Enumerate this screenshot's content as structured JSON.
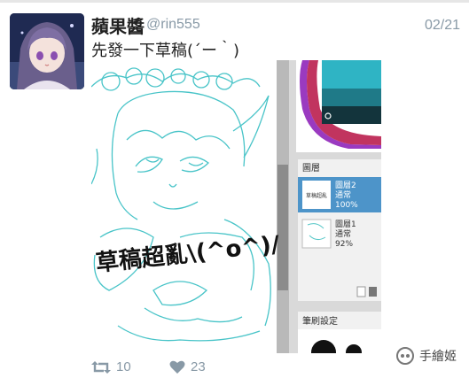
{
  "tweet": {
    "display_name": "蘋果醬",
    "handle": "@rin555",
    "date": "02/21",
    "text": "先發一下草稿(´ー｀)",
    "retweets": "10",
    "likes": "23"
  },
  "media": {
    "overlay_text": "草稿超亂\\(^o^)/",
    "layers_panel_title": "圖層",
    "layers": [
      {
        "name": "圖層2",
        "mode": "通常",
        "opacity": "100%"
      },
      {
        "name": "圖層1",
        "mode": "通常",
        "opacity": "92%"
      }
    ],
    "brush_panel_title": "筆刷設定"
  },
  "watermark": {
    "text": "手繪姬"
  }
}
